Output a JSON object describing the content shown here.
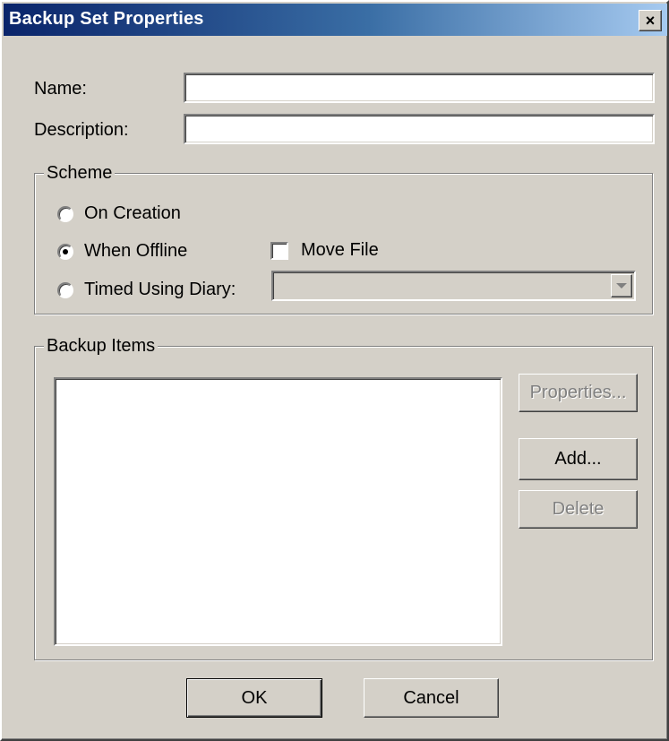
{
  "window": {
    "title": "Backup Set Properties",
    "close_glyph": "×",
    "close_icon": "close-icon"
  },
  "fields": {
    "name_label": "Name:",
    "name_value": "",
    "description_label": "Description:",
    "description_value": ""
  },
  "scheme": {
    "legend": "Scheme",
    "options": [
      {
        "label": "On Creation",
        "checked": false
      },
      {
        "label": "When Offline",
        "checked": true
      },
      {
        "label": "Timed Using Diary:",
        "checked": false
      }
    ],
    "move_file_label": "Move File",
    "move_file_checked": false,
    "diary_value": "",
    "dropdown_icon": "chevron-down-icon"
  },
  "backup_items": {
    "legend": "Backup Items",
    "items": [],
    "properties_label": "Properties...",
    "add_label": "Add...",
    "delete_label": "Delete"
  },
  "footer": {
    "ok_label": "OK",
    "cancel_label": "Cancel"
  },
  "colors": {
    "dialog_bg": "#d4d0c8",
    "titlebar_start": "#0a246a",
    "titlebar_end": "#a6caf0",
    "disabled_text": "#808080"
  }
}
